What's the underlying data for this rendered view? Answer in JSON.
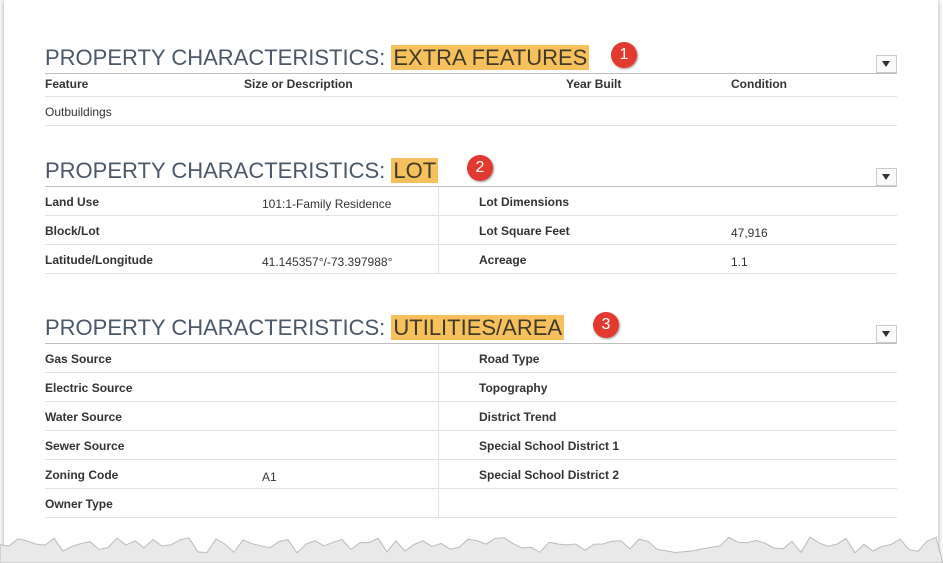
{
  "sections": [
    {
      "prefix": "PROPERTY CHARACTERISTICS: ",
      "highlight": "EXTRA FEATURES",
      "badge": "1",
      "columns": [
        "Feature",
        "Size or Description",
        "Year Built",
        "Condition"
      ],
      "rows": [
        [
          "Outbuildings",
          "",
          "",
          ""
        ]
      ]
    },
    {
      "prefix": "PROPERTY CHARACTERISTICS: ",
      "highlight": "LOT",
      "badge": "2",
      "rows": [
        {
          "l_label": "Land Use",
          "l_value": "101:1-Family Residence",
          "r_label": "Lot Dimensions",
          "r_value": ""
        },
        {
          "l_label": "Block/Lot",
          "l_value": "",
          "r_label": "Lot Square Feet",
          "r_value": "47,916"
        },
        {
          "l_label": "Latitude/Longitude",
          "l_value": "41.145357°/-73.397988°",
          "r_label": "Acreage",
          "r_value": "1.1"
        }
      ]
    },
    {
      "prefix": "PROPERTY CHARACTERISTICS: ",
      "highlight": "UTILITIES/AREA",
      "badge": "3",
      "rows": [
        {
          "l_label": "Gas Source",
          "l_value": "",
          "r_label": "Road Type",
          "r_value": ""
        },
        {
          "l_label": "Electric Source",
          "l_value": "",
          "r_label": "Topography",
          "r_value": ""
        },
        {
          "l_label": "Water Source",
          "l_value": "",
          "r_label": "District Trend",
          "r_value": ""
        },
        {
          "l_label": "Sewer Source",
          "l_value": "",
          "r_label": "Special School District 1",
          "r_value": ""
        },
        {
          "l_label": "Zoning Code",
          "l_value": "A1",
          "r_label": "Special School District 2",
          "r_value": ""
        },
        {
          "l_label": "Owner Type",
          "l_value": "",
          "r_label": "",
          "r_value": ""
        }
      ]
    }
  ],
  "colors": {
    "highlight": "#f6c15c",
    "badge": "#e23a2e",
    "title": "#4b5867"
  }
}
